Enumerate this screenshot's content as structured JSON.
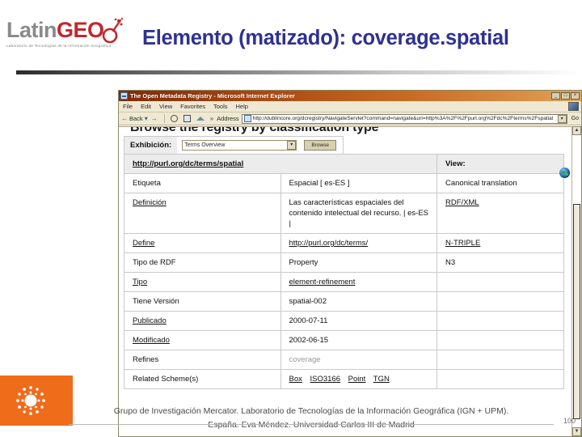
{
  "slide": {
    "title": "Elemento (matizado): coverage.spatial",
    "logo": {
      "latin": "Latin",
      "geo": "GEO",
      "tagline": "Laboratorio de Tecnologías de la Información Geográfica"
    },
    "footer": {
      "line1": "Grupo de Investigación Mercator. Laboratorio de Tecnologías de la Información Geográfica (IGN + UPM).",
      "line2": "España.  Eva Méndez. Universidad Carlos III de Madrid",
      "page_number": "100"
    }
  },
  "browser": {
    "title": "The Open Metadata Registry - Microsoft Internet Explorer",
    "window_buttons": [
      "_",
      "□",
      "×"
    ],
    "menu": [
      "File",
      "Edit",
      "View",
      "Favorites",
      "Tools",
      "Help"
    ],
    "toolbar": {
      "back_label": "Back",
      "chevrons": "»",
      "address_label": "Address",
      "url": "http://dublincore.org/dcregistry/NavigateServlet?command=navigate&uri=http%3A%2F%2Fpurl.org%2Fdc%2Fterms%2Fspatial",
      "go_label": "Go"
    }
  },
  "page": {
    "heading": "Browse the registry by classification type",
    "exhibition": {
      "label": "Exhibición:",
      "selected": "Terms Overview",
      "browse_button": "Browse"
    },
    "table": {
      "header_uri": "http://purl.org/dc/terms/spatial",
      "header_view": "View:",
      "rows": [
        {
          "key": "Etiqueta",
          "key_link": false,
          "value": "Espacial [ es-ES ]",
          "value_link": false,
          "muted": false
        },
        {
          "key": "Definición",
          "key_link": true,
          "value": "Las características espaciales del contenido intelectual del recurso. | es-ES |",
          "value_link": false,
          "muted": false
        },
        {
          "key": "Define",
          "key_link": true,
          "value": "http://purl.org/dc/terms/",
          "value_link": true,
          "muted": false
        },
        {
          "key": "Tipo de RDF",
          "key_link": false,
          "value": "Property",
          "value_link": false,
          "muted": false
        },
        {
          "key": "Tipo",
          "key_link": true,
          "value": "element-refinement",
          "value_link": true,
          "muted": false
        },
        {
          "key": "Tiene Versión",
          "key_link": false,
          "value": "spatial-002",
          "value_link": false,
          "muted": false
        },
        {
          "key": "Publicado",
          "key_link": true,
          "value": "2000-07-11",
          "value_link": false,
          "muted": false
        },
        {
          "key": "Modificado",
          "key_link": true,
          "value": "2002-06-15",
          "value_link": false,
          "muted": false
        },
        {
          "key": "Refines",
          "key_link": false,
          "value": "coverage",
          "value_link": false,
          "muted": true
        }
      ],
      "related": {
        "key": "Related Scheme(s)",
        "links": [
          "Box",
          "ISO3166",
          "Point",
          "TGN"
        ]
      },
      "view_options": [
        {
          "label": "Canonical translation",
          "link": false
        },
        {
          "label": "RDF/XML",
          "link": true
        },
        {
          "label": "N-TRIPLE",
          "link": true
        },
        {
          "label": "N3",
          "link": false
        }
      ]
    }
  },
  "colors": {
    "title_blue": "#2e3192",
    "logo_red": "#c1272d",
    "logo_gray": "#888a8c",
    "accent_orange": "#ef6c1a"
  }
}
